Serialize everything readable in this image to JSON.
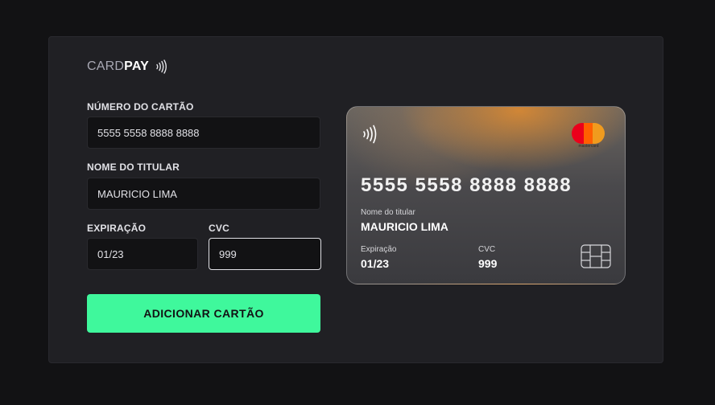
{
  "brand": {
    "light": "CARD",
    "bold": "PAY"
  },
  "form": {
    "card_number": {
      "label": "NÚMERO DO CARTÃO",
      "value": "5555 5558 8888 8888"
    },
    "holder_name": {
      "label": "NOME DO TITULAR",
      "value": "MAURICIO LIMA"
    },
    "expiration": {
      "label": "EXPIRAÇÃO",
      "value": "01/23"
    },
    "cvc": {
      "label": "CVC",
      "value": "999"
    },
    "submit_label": "ADICIONAR CARTÃO"
  },
  "card_preview": {
    "number": "5555 5558 8888 8888",
    "holder_label": "Nome do titular",
    "holder_name": "MAURICIO LIMA",
    "expiration_label": "Expiração",
    "expiration_value": "01/23",
    "cvc_label": "CVC",
    "cvc_value": "999",
    "network": "mastercard",
    "network_icon": "mastercard-logo"
  },
  "colors": {
    "accent": "#3ff89c",
    "background": "#121214",
    "panel": "#202024"
  },
  "icons": [
    "contactless-icon",
    "mastercard-logo",
    "chip-icon"
  ]
}
